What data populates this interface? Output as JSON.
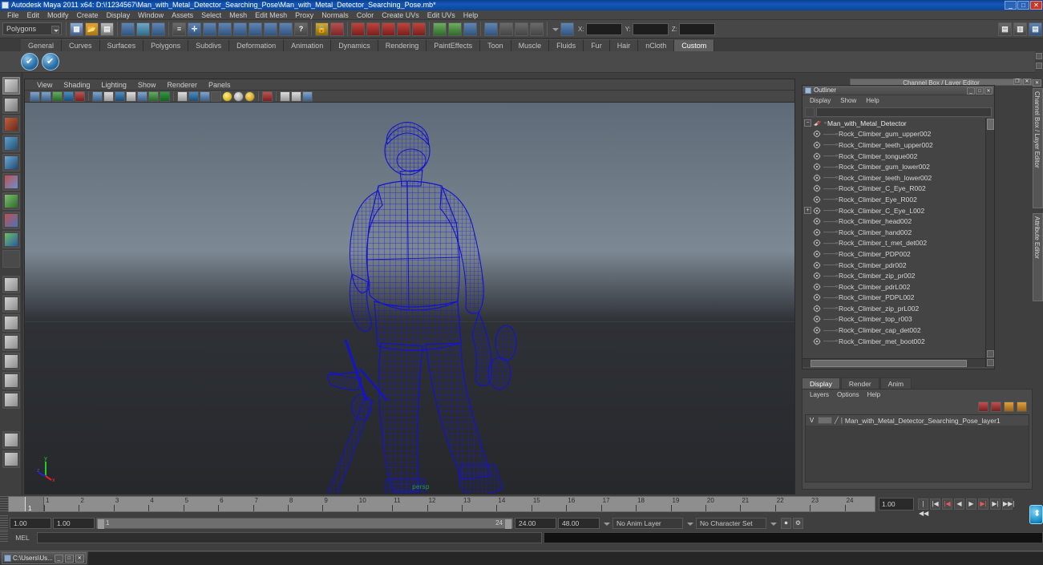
{
  "window": {
    "title": "Autodesk Maya 2011 x64: D:\\!1234567\\Man_with_Metal_Detector_Searching_Pose\\Man_with_Metal_Detector_Searching_Pose.mb*",
    "minimize": "_",
    "maximize": "□",
    "close": "✕"
  },
  "menubar": {
    "items": [
      "File",
      "Edit",
      "Modify",
      "Create",
      "Display",
      "Window",
      "Assets",
      "Select",
      "Mesh",
      "Edit Mesh",
      "Proxy",
      "Normals",
      "Color",
      "Create UVs",
      "Edit UVs",
      "Help"
    ]
  },
  "statusline": {
    "mode_selector": "Polygons",
    "coord_labels": [
      "X:",
      "Y:",
      "Z:"
    ],
    "coord_values": [
      "",
      "",
      ""
    ],
    "icons": [
      "pdf-export-icon",
      "open-scene-icon",
      "save-scene-icon",
      "select-by-hierarchy-icon",
      "select-by-object-icon",
      "select-by-component-icon",
      "component-mask-icon",
      "mask-all-icon",
      "mask-handles-icon",
      "mask-curve-icon",
      "mask-surface-icon",
      "mask-deform-icon",
      "mask-dynamic-icon",
      "mask-render-icon",
      "mask-misc-icon",
      "lock-icon",
      "highlight-icon",
      "snap-grid-icon",
      "snap-curve-icon",
      "snap-point-icon",
      "snap-plane-icon",
      "snap-view-icon",
      "snap-live-icon",
      "construction-history-icon",
      "render-current-icon",
      "ipr-render-icon",
      "render-settings-icon",
      "open-render-view-icon",
      "render-globals-icon",
      "hypershade-icon"
    ]
  },
  "shelf": {
    "tabs": [
      "General",
      "Curves",
      "Surfaces",
      "Polygons",
      "Subdivs",
      "Deformation",
      "Animation",
      "Dynamics",
      "Rendering",
      "PaintEffects",
      "Toon",
      "Muscle",
      "Fluids",
      "Fur",
      "Hair",
      "nCloth",
      "Custom"
    ],
    "active_tab": "Custom",
    "buttons": [
      "custom-check-icon-1",
      "custom-check-icon-2"
    ]
  },
  "toolbox": {
    "tools": [
      {
        "name": "select-tool",
        "selected": true
      },
      {
        "name": "lasso-select-tool",
        "selected": false
      },
      {
        "name": "paint-select-tool",
        "selected": false
      },
      {
        "name": "move-tool",
        "selected": false
      },
      {
        "name": "rotate-tool",
        "selected": false
      },
      {
        "name": "scale-tool",
        "selected": false
      },
      {
        "name": "universal-manipulator-tool",
        "selected": false
      },
      {
        "name": "soft-modification-tool",
        "selected": false
      },
      {
        "name": "show-manipulator-tool",
        "selected": false
      },
      {
        "name": "last-tool-used",
        "selected": false
      },
      {
        "name": "single-perspective-layout",
        "selected": false
      },
      {
        "name": "four-view-layout",
        "selected": false
      },
      {
        "name": "persp-outliner-layout",
        "selected": false
      },
      {
        "name": "persp-graph-layout",
        "selected": false
      },
      {
        "name": "hypershade-persp-layout",
        "selected": false
      },
      {
        "name": "persp-uv-layout",
        "selected": false
      },
      {
        "name": "outliner-persp-layout",
        "selected": false
      },
      {
        "name": "saved-layout-blank",
        "selected": false
      },
      {
        "name": "paint-effects-layout",
        "selected": false
      }
    ]
  },
  "viewport": {
    "menus": [
      "View",
      "Shading",
      "Lighting",
      "Show",
      "Renderer",
      "Panels"
    ],
    "camera_label": "persp",
    "axis": {
      "x": "x",
      "y": "y",
      "z": "z"
    },
    "toolbar_icons": [
      "select-camera-icon",
      "lock-camera-icon",
      "bookmark-icon",
      "image-plane-icon",
      "hud-icon",
      "resolution-gate-icon",
      "film-gate-icon",
      "exposure-icon",
      "grid-toggle-icon",
      "film-back-icon",
      "xray-icon",
      "texture-icon",
      "wireframe-shaded-icon",
      "smooth-shade-icon",
      "flat-shade-icon",
      "wireframe-icon",
      "hardware-texture-icon",
      "default-light-icon",
      "all-lights-icon",
      "shadows-icon",
      "xray-joints-icon",
      "isolate-select-icon",
      "bounding-box-icon",
      "smooth-wire-icon",
      "paint-effects-toggle-icon"
    ]
  },
  "outliner": {
    "window_title": "Outliner",
    "window_buttons": [
      "_",
      "□",
      "✕"
    ],
    "menus": [
      "Display",
      "Show",
      "Help"
    ],
    "search_value": "",
    "items": [
      {
        "label": "Man_with_Metal_Detector",
        "root": true,
        "expanded": true
      },
      {
        "label": "Rock_Climber_gum_upper002",
        "root": false
      },
      {
        "label": "Rock_Climber_teeth_upper002",
        "root": false
      },
      {
        "label": "Rock_Climber_tongue002",
        "root": false
      },
      {
        "label": "Rock_Climber_gum_lower002",
        "root": false
      },
      {
        "label": "Rock_Climber_teeth_lower002",
        "root": false
      },
      {
        "label": "Rock_Climber_C_Eye_R002",
        "root": false
      },
      {
        "label": "Rock_Climber_Eye_R002",
        "root": false
      },
      {
        "label": "Rock_Climber_C_Eye_L002",
        "root": false,
        "has_expand": true
      },
      {
        "label": "Rock_Climber_head002",
        "root": false
      },
      {
        "label": "Rock_Climber_hand002",
        "root": false
      },
      {
        "label": "Rock_Climber_t_met_det002",
        "root": false
      },
      {
        "label": "Rock_Climber_PDP002",
        "root": false
      },
      {
        "label": "Rock_Climber_pdr002",
        "root": false
      },
      {
        "label": "Rock_Climber_zip_pr002",
        "root": false
      },
      {
        "label": "Rock_Climber_pdrL002",
        "root": false
      },
      {
        "label": "Rock_Climber_PDPL002",
        "root": false
      },
      {
        "label": "Rock_Climber_zip_prL002",
        "root": false
      },
      {
        "label": "Rock_Climber_top_r003",
        "root": false
      },
      {
        "label": "Rock_Climber_cap_det002",
        "root": false
      },
      {
        "label": "Rock_Climber_met_boot002",
        "root": false
      }
    ]
  },
  "channel_box": {
    "title": "Channel Box / Layer Editor"
  },
  "layer_editor": {
    "tabs": [
      "Display",
      "Render",
      "Anim"
    ],
    "active_tab": "Display",
    "menus": [
      "Layers",
      "Options",
      "Help"
    ],
    "buttons": [
      "new-layer-icon",
      "new-layer-from-selected-icon",
      "move-layer-up-icon",
      "move-layer-down-icon"
    ],
    "layers": [
      {
        "visibility": "V",
        "playback": "",
        "name": "Man_with_Metal_Detector_Searching_Pose_layer1"
      }
    ]
  },
  "right_tabs": [
    "Channel Box / Layer Editor",
    "Attribute Editor"
  ],
  "timeline": {
    "ticks": [
      "1",
      "2",
      "3",
      "4",
      "5",
      "6",
      "7",
      "8",
      "9",
      "10",
      "11",
      "12",
      "13",
      "14",
      "15",
      "16",
      "17",
      "18",
      "19",
      "20",
      "21",
      "22",
      "23",
      "24"
    ],
    "current_frame_label": "1",
    "current_frame_value": "1.00",
    "playback_buttons": [
      "go-to-start-icon",
      "step-back-key-icon",
      "step-back-frame-icon",
      "play-backwards-icon",
      "play-forwards-icon",
      "step-forward-frame-icon",
      "step-forward-key-icon",
      "go-to-end-icon"
    ]
  },
  "range_slider": {
    "start_field": "1.00",
    "end_field": "1.00",
    "range_left_label": "1",
    "range_right_label": "24",
    "anim_start": "24.00",
    "anim_end": "48.00",
    "anim_layer": "No Anim Layer",
    "character_set": "No Character Set"
  },
  "command_line": {
    "label": "MEL",
    "input_value": "",
    "output_value": ""
  },
  "taskbar": {
    "items": [
      {
        "label": "C:\\Users\\Us...",
        "buttons": [
          "_",
          "□",
          "✕"
        ]
      }
    ]
  },
  "colors": {
    "title_blue": "#1458b8",
    "panel_gray": "#4a4a4a",
    "wireframe_blue": "#1414cc",
    "persp_green": "#1f9e4a",
    "timeline_gray": "#8e8e8e"
  }
}
